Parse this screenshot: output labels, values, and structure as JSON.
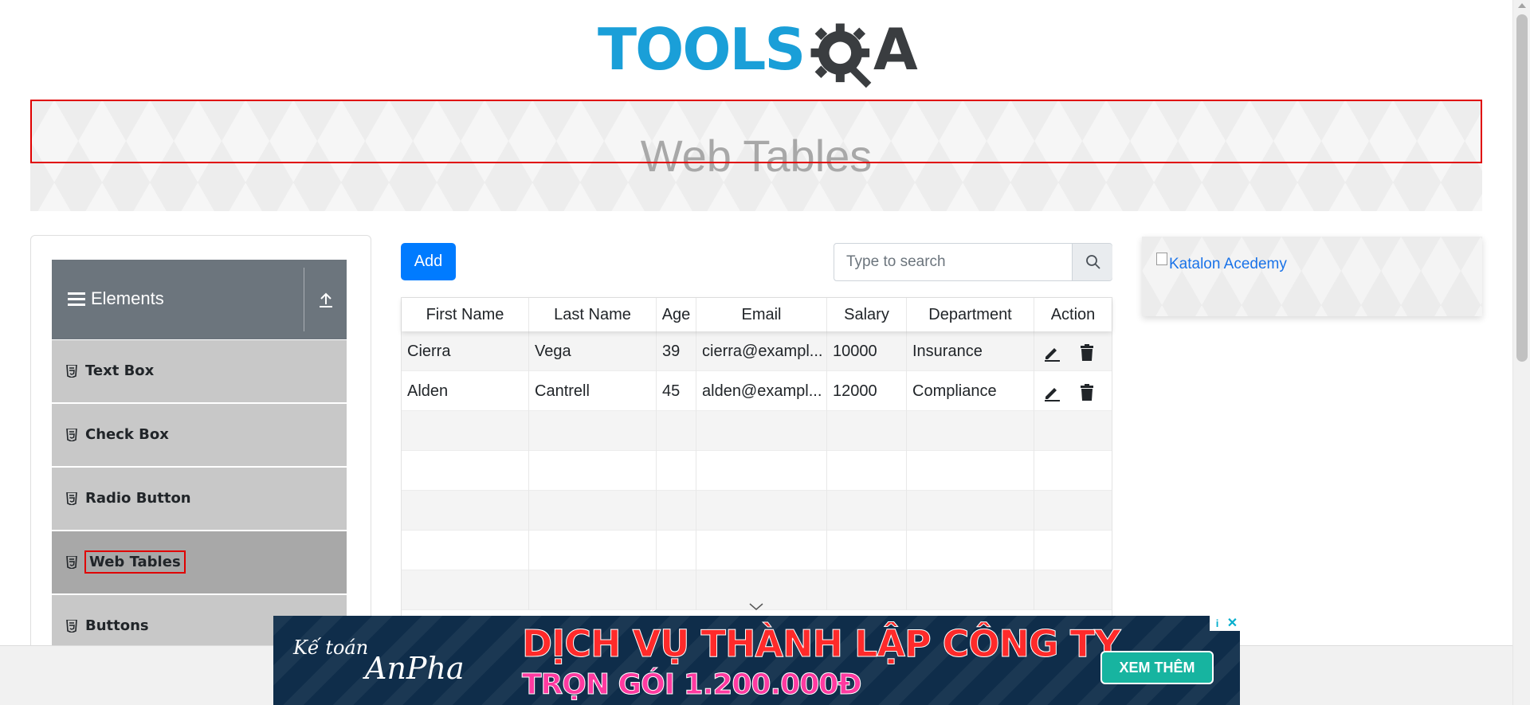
{
  "logo": {
    "part1": "TOOLS",
    "part2": "A",
    "colors": {
      "blue": "#1a9fd8",
      "dark": "#3a3d40"
    }
  },
  "banner": {
    "title": "Web Tables"
  },
  "sidebar": {
    "group_title": "Elements",
    "items": [
      {
        "label": "Text Box",
        "icon": "html5-icon"
      },
      {
        "label": "Check Box",
        "icon": "html5-icon"
      },
      {
        "label": "Radio Button",
        "icon": "html5-icon"
      },
      {
        "label": "Web Tables",
        "icon": "html5-icon",
        "active": true
      },
      {
        "label": "Buttons",
        "icon": "html5-icon"
      }
    ]
  },
  "toolbar": {
    "add_label": "Add",
    "search_placeholder": "Type to search"
  },
  "table": {
    "headers": [
      "First Name",
      "Last Name",
      "Age",
      "Email",
      "Salary",
      "Department",
      "Action"
    ],
    "rows": [
      [
        "Cierra",
        "Vega",
        "39",
        "cierra@exampl...",
        "10000",
        "Insurance"
      ],
      [
        "Alden",
        "Cantrell",
        "45",
        "alden@exampl...",
        "12000",
        "Compliance"
      ]
    ]
  },
  "right_ad": {
    "alt_text": "Katalon Acedemy"
  },
  "bottom_ad": {
    "brand_line1": "Kế toán",
    "brand_line2": "AnPha",
    "headline": "DỊCH VỤ THÀNH LẬP CÔNG TY",
    "subline": "TRỌN GÓI 1.200.000Đ",
    "cta": "XEM THÊM",
    "info": "i",
    "close": "✕"
  },
  "colors": {
    "primary": "#007bff",
    "highlight_border": "#e00000",
    "sidebar_header": "#6c757d",
    "menu_item": "#c8c8c8",
    "menu_active": "#a8a8a8"
  }
}
